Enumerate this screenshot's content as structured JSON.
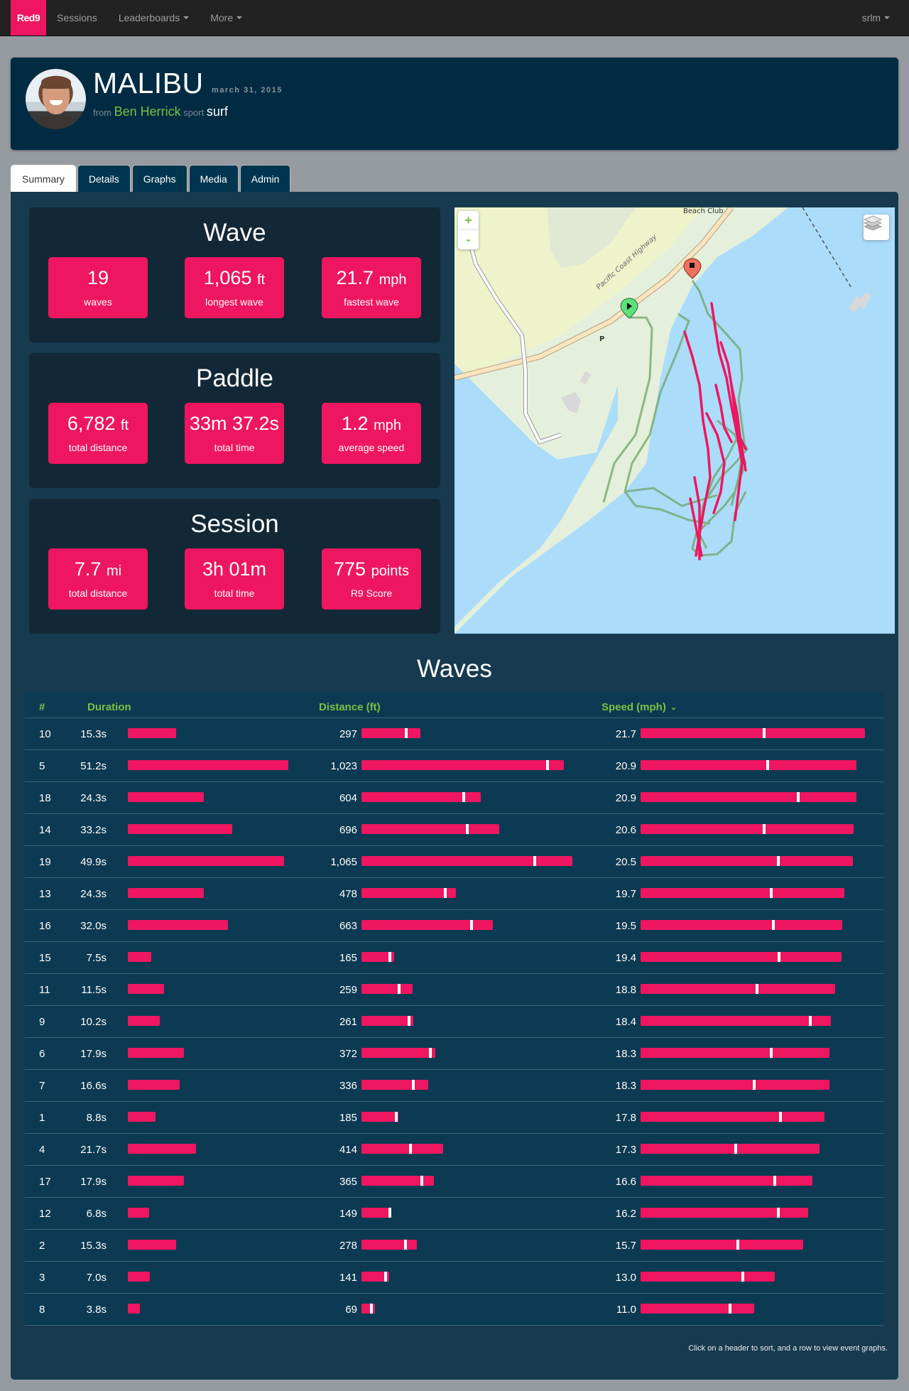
{
  "nav": {
    "brand": "Red9",
    "items": [
      {
        "label": "Sessions",
        "dropdown": false
      },
      {
        "label": "Leaderboards",
        "dropdown": true
      },
      {
        "label": "More",
        "dropdown": true
      }
    ],
    "user_menu": "srlm"
  },
  "session": {
    "title": "MALIBU",
    "date": "march 31, 2015",
    "from_label": "from",
    "user": "Ben Herrick",
    "sport_label": "sport",
    "sport": "surf"
  },
  "tabs": [
    {
      "label": "Summary",
      "active": true
    },
    {
      "label": "Details",
      "active": false
    },
    {
      "label": "Graphs",
      "active": false
    },
    {
      "label": "Media",
      "active": false
    },
    {
      "label": "Admin",
      "active": false
    }
  ],
  "stats": [
    {
      "title": "Wave",
      "boxes": [
        {
          "value": "19",
          "unit": "",
          "label": "waves"
        },
        {
          "value": "1,065",
          "unit": "ft",
          "label": "longest wave"
        },
        {
          "value": "21.7",
          "unit": "mph",
          "label": "fastest wave"
        }
      ]
    },
    {
      "title": "Paddle",
      "boxes": [
        {
          "value": "6,782",
          "unit": "ft",
          "label": "total distance"
        },
        {
          "value": "33m 37.2s",
          "unit": "",
          "label": "total time"
        },
        {
          "value": "1.2",
          "unit": "mph",
          "label": "average speed"
        }
      ]
    },
    {
      "title": "Session",
      "boxes": [
        {
          "value": "7.7",
          "unit": "mi",
          "label": "total distance"
        },
        {
          "value": "3h 01m",
          "unit": "",
          "label": "total time"
        },
        {
          "value": "775",
          "unit": "points",
          "label": "R9 Score"
        }
      ]
    }
  ],
  "map": {
    "zoom_in": "+",
    "zoom_out": "-",
    "labels": {
      "beach_club": "Beach Club",
      "highway": "Pacific Coast Highway",
      "parking": "P"
    },
    "colors": {
      "water": "#abdcfa",
      "land": "#e4efdc",
      "park": "#eef3cc",
      "wave_track": "#ee1660",
      "paddle_track": "#6fa566"
    }
  },
  "waves": {
    "title": "Waves",
    "columns": {
      "num": "#",
      "duration": "Duration",
      "distance": "Distance (ft)",
      "speed": "Speed (mph)"
    },
    "sorted_by": "speed",
    "hint": "Click on a header to sort, and a row to view event graphs.",
    "max": {
      "duration": 51.2,
      "distance": 1065,
      "speed": 21.7
    },
    "rows": [
      {
        "num": "10",
        "duration": "15.3s",
        "duration_v": 15.3,
        "distance": "297",
        "distance_v": 297,
        "distance_marker": 0.76,
        "speed": "21.7",
        "speed_v": 21.7,
        "speed_marker": 0.55
      },
      {
        "num": "5",
        "duration": "51.2s",
        "duration_v": 51.2,
        "distance": "1,023",
        "distance_v": 1023,
        "distance_marker": 0.92,
        "speed": "20.9",
        "speed_v": 20.9,
        "speed_marker": 0.59
      },
      {
        "num": "18",
        "duration": "24.3s",
        "duration_v": 24.3,
        "distance": "604",
        "distance_v": 604,
        "distance_marker": 0.86,
        "speed": "20.9",
        "speed_v": 20.9,
        "speed_marker": 0.73
      },
      {
        "num": "14",
        "duration": "33.2s",
        "duration_v": 33.2,
        "distance": "696",
        "distance_v": 696,
        "distance_marker": 0.77,
        "speed": "20.6",
        "speed_v": 20.6,
        "speed_marker": 0.58
      },
      {
        "num": "19",
        "duration": "49.9s",
        "duration_v": 49.9,
        "distance": "1,065",
        "distance_v": 1065,
        "distance_marker": 0.82,
        "speed": "20.5",
        "speed_v": 20.5,
        "speed_marker": 0.65
      },
      {
        "num": "13",
        "duration": "24.3s",
        "duration_v": 24.3,
        "distance": "478",
        "distance_v": 478,
        "distance_marker": 0.89,
        "speed": "19.7",
        "speed_v": 19.7,
        "speed_marker": 0.64
      },
      {
        "num": "16",
        "duration": "32.0s",
        "duration_v": 32.0,
        "distance": "663",
        "distance_v": 663,
        "distance_marker": 0.84,
        "speed": "19.5",
        "speed_v": 19.5,
        "speed_marker": 0.66
      },
      {
        "num": "15",
        "duration": "7.5s",
        "duration_v": 7.5,
        "distance": "165",
        "distance_v": 165,
        "distance_marker": 0.86,
        "speed": "19.4",
        "speed_v": 19.4,
        "speed_marker": 0.69
      },
      {
        "num": "11",
        "duration": "11.5s",
        "duration_v": 11.5,
        "distance": "259",
        "distance_v": 259,
        "distance_marker": 0.74,
        "speed": "18.8",
        "speed_v": 18.8,
        "speed_marker": 0.6
      },
      {
        "num": "9",
        "duration": "10.2s",
        "duration_v": 10.2,
        "distance": "261",
        "distance_v": 261,
        "distance_marker": 0.92,
        "speed": "18.4",
        "speed_v": 18.4,
        "speed_marker": 0.89
      },
      {
        "num": "6",
        "duration": "17.9s",
        "duration_v": 17.9,
        "distance": "372",
        "distance_v": 372,
        "distance_marker": 0.93,
        "speed": "18.3",
        "speed_v": 18.3,
        "speed_marker": 0.69
      },
      {
        "num": "7",
        "duration": "16.6s",
        "duration_v": 16.6,
        "distance": "336",
        "distance_v": 336,
        "distance_marker": 0.78,
        "speed": "18.3",
        "speed_v": 18.3,
        "speed_marker": 0.6
      },
      {
        "num": "1",
        "duration": "8.8s",
        "duration_v": 8.8,
        "distance": "185",
        "distance_v": 185,
        "distance_marker": 0.94,
        "speed": "17.8",
        "speed_v": 17.8,
        "speed_marker": 0.76
      },
      {
        "num": "4",
        "duration": "21.7s",
        "duration_v": 21.7,
        "distance": "414",
        "distance_v": 414,
        "distance_marker": 0.6,
        "speed": "17.3",
        "speed_v": 17.3,
        "speed_marker": 0.53
      },
      {
        "num": "17",
        "duration": "17.9s",
        "duration_v": 17.9,
        "distance": "365",
        "distance_v": 365,
        "distance_marker": 0.83,
        "speed": "16.6",
        "speed_v": 16.6,
        "speed_marker": 0.78
      },
      {
        "num": "12",
        "duration": "6.8s",
        "duration_v": 6.8,
        "distance": "149",
        "distance_v": 149,
        "distance_marker": 0.95,
        "speed": "16.2",
        "speed_v": 16.2,
        "speed_marker": 0.82
      },
      {
        "num": "2",
        "duration": "15.3s",
        "duration_v": 15.3,
        "distance": "278",
        "distance_v": 278,
        "distance_marker": 0.79,
        "speed": "15.7",
        "speed_v": 15.7,
        "speed_marker": 0.6
      },
      {
        "num": "3",
        "duration": "7.0s",
        "duration_v": 7.0,
        "distance": "141",
        "distance_v": 141,
        "distance_marker": 0.86,
        "speed": "13.0",
        "speed_v": 13.0,
        "speed_marker": 0.76
      },
      {
        "num": "8",
        "duration": "3.8s",
        "duration_v": 3.8,
        "distance": "69",
        "distance_v": 69,
        "distance_marker": 0.72,
        "speed": "11.0",
        "speed_v": 11.0,
        "speed_marker": 0.79
      }
    ]
  }
}
